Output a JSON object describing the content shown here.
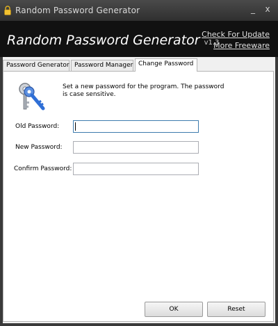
{
  "window": {
    "title": "Random Password Generator",
    "minimize_glyph": "_",
    "close_glyph": "x",
    "icon": "lock-icon"
  },
  "header": {
    "app_name": "Random Password Generator",
    "version": "v1.3",
    "link_update": "Check For Update",
    "link_freeware": "More Freeware"
  },
  "tabs": [
    {
      "label": "Password Generator",
      "active": false
    },
    {
      "label": "Password Manager",
      "active": false
    },
    {
      "label": "Change Password",
      "active": true
    }
  ],
  "change_password": {
    "icon": "keys-icon",
    "description": "Set a new password for the program. The password is case sensitive.",
    "old_label": "Old Password:",
    "old_value": "",
    "new_label": "New Password:",
    "new_value": "",
    "confirm_label": "Confirm Password:",
    "confirm_value": "",
    "ok_label": "OK",
    "reset_label": "Reset"
  },
  "colors": {
    "title_bar": "#2f2f2f",
    "header_bg": "#111111",
    "focus_border": "#3d7bad",
    "key_blue": "#2f6fd6"
  }
}
